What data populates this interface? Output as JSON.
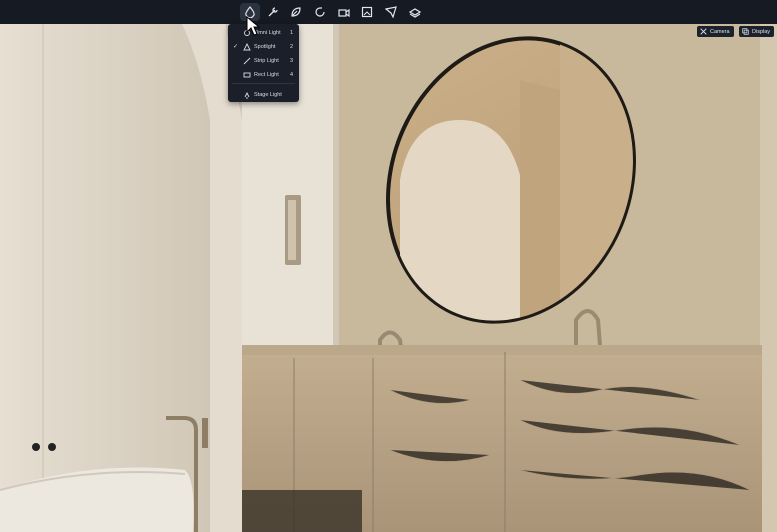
{
  "toolbar": {
    "tools": [
      {
        "icon": "droplet-light-icon",
        "active": true
      },
      {
        "icon": "wrench-icon",
        "active": false
      },
      {
        "icon": "leaf-icon",
        "active": false
      },
      {
        "icon": "refresh-icon",
        "active": false
      },
      {
        "icon": "camera-record-icon",
        "active": false
      },
      {
        "icon": "image-icon",
        "active": false
      },
      {
        "icon": "send-icon",
        "active": false
      },
      {
        "icon": "layers-icon",
        "active": false
      }
    ]
  },
  "light_menu": {
    "items": [
      {
        "label": "Omni Light",
        "shortcut": "1",
        "checked": false,
        "icon": "bulb-icon"
      },
      {
        "label": "Spotlight",
        "shortcut": "2",
        "checked": true,
        "icon": "spotlight-icon"
      },
      {
        "label": "Strip Light",
        "shortcut": "3",
        "checked": false,
        "icon": "strip-light-icon"
      },
      {
        "label": "Rect Light",
        "shortcut": "4",
        "checked": false,
        "icon": "rect-light-icon"
      }
    ],
    "extra": {
      "label": "Stage Light",
      "icon": "stage-light-icon"
    }
  },
  "view_buttons": {
    "camera": "Camera",
    "display": "Display"
  },
  "colors": {
    "toolbar_bg": "#151a23",
    "menu_bg": "#1a1f29",
    "wall": "#ddd4c3",
    "wood": "#b49e80"
  }
}
